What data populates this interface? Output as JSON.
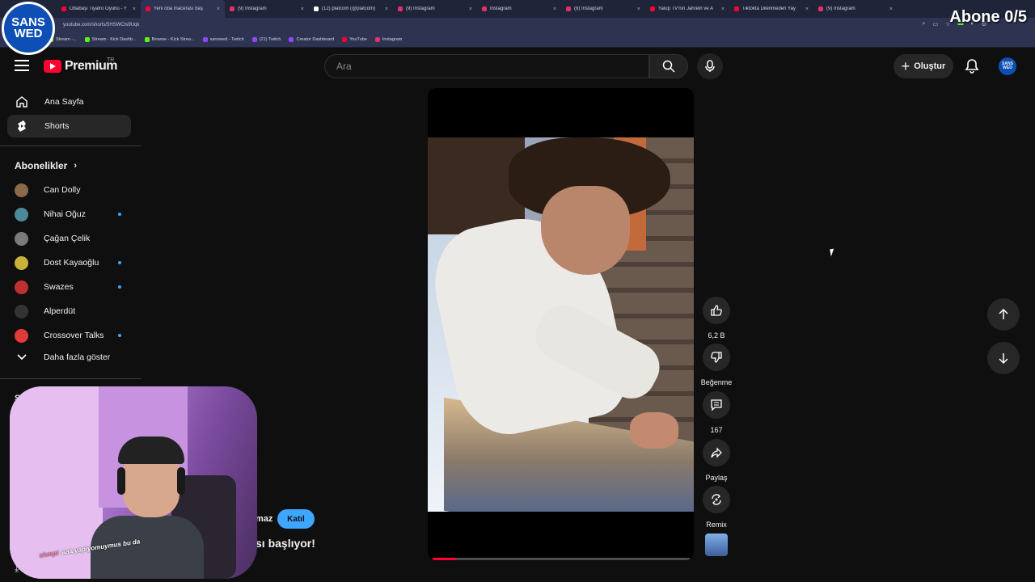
{
  "overlay": {
    "logo_text_top": "SANS",
    "logo_text_bottom": "WED",
    "subscriber_goal": "Abone 0/5"
  },
  "browser": {
    "tabs": [
      {
        "title": "Obabaşı Tiyatro Oyunu - Y",
        "color": "#ff0033",
        "active": false
      },
      {
        "title": "Yeni oba macerası baş",
        "color": "#ff0033",
        "active": true
      },
      {
        "title": "(9) Instagram",
        "color": "#e1306c",
        "active": false
      },
      {
        "title": "(12) platcom (@platcom)",
        "color": "#ffffff",
        "active": false
      },
      {
        "title": "(9) Instagram",
        "color": "#e1306c",
        "active": false
      },
      {
        "title": "Instagram",
        "color": "#e1306c",
        "active": false
      },
      {
        "title": "(9) Instagram",
        "color": "#e1306c",
        "active": false
      },
      {
        "title": "Yalup TV'nin Jahrein ve A",
        "color": "#ff0033",
        "active": false
      },
      {
        "title": "Tiktokta Dilenmeden Yay",
        "color": "#ff0033",
        "active": false
      },
      {
        "title": "(9) Instagram",
        "color": "#e1306c",
        "active": false
      }
    ],
    "url": "youtube.com/shorts/5HSWCts9Uqk",
    "bookmarks": [
      {
        "label": "Stream -...",
        "color": "#53fc18"
      },
      {
        "label": "Stream - Kick Dashb...",
        "color": "#53fc18"
      },
      {
        "label": "Browse - Kick Strea...",
        "color": "#53fc18"
      },
      {
        "label": "sanswed - Twitch",
        "color": "#9146ff"
      },
      {
        "label": "(21) Twitch",
        "color": "#9146ff"
      },
      {
        "label": "Creator Dashboard",
        "color": "#9146ff"
      },
      {
        "label": "YouTube",
        "color": "#ff0033"
      },
      {
        "label": "Instagram",
        "color": "#e1306c"
      }
    ]
  },
  "header": {
    "brand": "Premium",
    "region": "TR",
    "search_placeholder": "Ara",
    "create_label": "Oluştur",
    "avatar_text": "SANS WED"
  },
  "sidebar": {
    "home_label": "Ana Sayfa",
    "shorts_label": "Shorts",
    "subscriptions_title": "Abonelikler",
    "subscriptions": [
      {
        "name": "Can Dolly",
        "color": "#8a6a4a",
        "new": false
      },
      {
        "name": "Nihai Oğuz",
        "color": "#4a8a9a",
        "new": true
      },
      {
        "name": "Çağan Çelik",
        "color": "#7a7a7a",
        "new": false
      },
      {
        "name": "Dost Kayaoğlu",
        "color": "#c9b23a",
        "new": true
      },
      {
        "name": "Swazes",
        "color": "#c03030",
        "new": true
      },
      {
        "name": "Alperdüt",
        "color": "#333333",
        "new": false
      },
      {
        "name": "Crossover Talks",
        "color": "#e03a3a",
        "new": true
      }
    ],
    "show_more_label": "Daha fazla göster",
    "section_partial": "Si"
  },
  "webcam": {
    "chat_name": "shmpi",
    "chat_message": ": aaa yapiyomuymus bu da"
  },
  "behind": {
    "partial_text": "maz",
    "join_label": "Katıl",
    "title_partial": "sı başlıyor!"
  },
  "video": {
    "progress": 0.09
  },
  "actions": {
    "like_count": "6,2 B",
    "dislike_label": "Beğenme",
    "comment_count": "167",
    "share_label": "Paylaş",
    "remix_label": "Remix"
  }
}
